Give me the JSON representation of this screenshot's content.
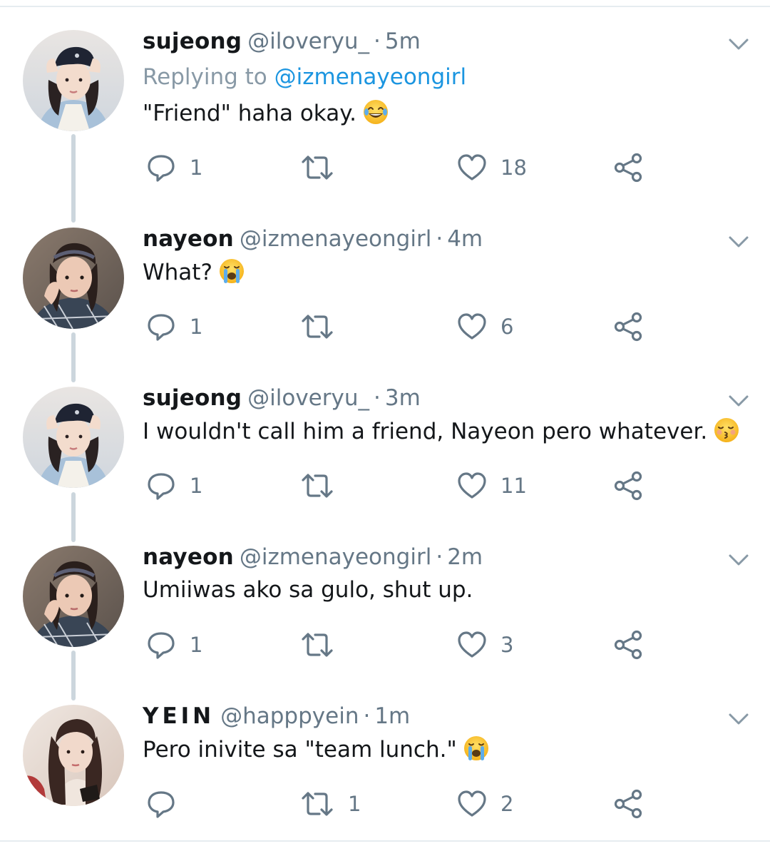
{
  "tweets": [
    {
      "name": "sujeong",
      "handle": "@iloveryu_",
      "separator": "·",
      "time": "5m",
      "replying_prefix": "Replying to ",
      "replying_to": "@izmenayeongirl",
      "text": "\"Friend\" haha okay.",
      "emoji": "joy-emoji",
      "counts": {
        "reply": "1",
        "retweet": "",
        "like": "18"
      }
    },
    {
      "name": "nayeon",
      "handle": "@izmenayeongirl",
      "separator": "·",
      "time": "4m",
      "text": "What?",
      "emoji": "loudly-crying-emoji",
      "counts": {
        "reply": "1",
        "retweet": "",
        "like": "6"
      }
    },
    {
      "name": "sujeong",
      "handle": "@iloveryu_",
      "separator": "·",
      "time": "3m",
      "text": "I wouldn't call him a friend, Nayeon pero whatever.",
      "emoji": "kissing-closed-eyes-emoji",
      "counts": {
        "reply": "1",
        "retweet": "",
        "like": "11"
      }
    },
    {
      "name": "nayeon",
      "handle": "@izmenayeongirl",
      "separator": "·",
      "time": "2m",
      "text": "Umiiwas ako sa gulo, shut up.",
      "counts": {
        "reply": "1",
        "retweet": "",
        "like": "3"
      }
    },
    {
      "name": "YEIN",
      "handle": "@happpyein",
      "separator": "·",
      "time": "1m",
      "text": "Pero inivite sa \"team lunch.\"",
      "emoji": "loudly-crying-emoji",
      "counts": {
        "reply": "",
        "retweet": "1",
        "like": "2"
      }
    }
  ],
  "colors": {
    "text": "#14171a",
    "secondary": "#657786",
    "link": "#1b95e0",
    "thread_line": "#ccd6dd",
    "icon": "#657786"
  }
}
